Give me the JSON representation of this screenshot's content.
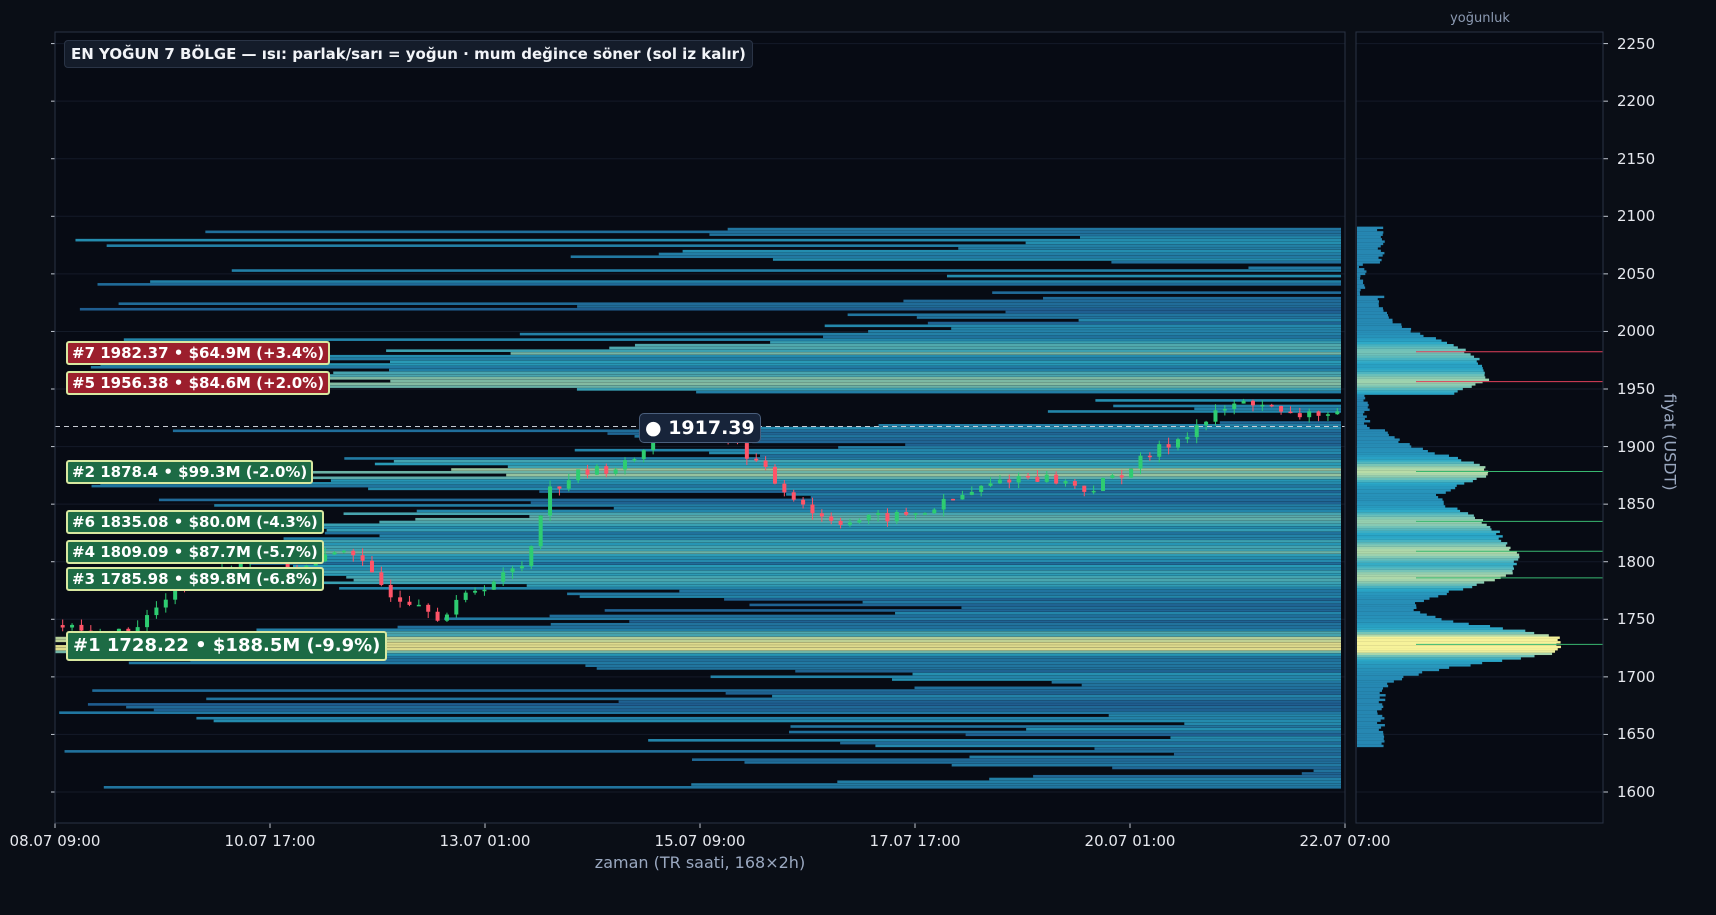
{
  "chart_data": {
    "type": "candlestick",
    "title": "EN YOĞUN 7 BÖLGE — ısı: parlak/sarı = yoğun · mum değince söner (sol iz kalır)",
    "xlabel": "zaman (TR saati, 168×2h)",
    "ylabel": "fiyat (USDT)",
    "profile_label": "yoğunluk",
    "ylim": [
      1575,
      2262
    ],
    "x_ticks": [
      "08.07 09:00",
      "10.07 17:00",
      "13.07 01:00",
      "15.07 09:00",
      "17.07 17:00",
      "20.07 01:00",
      "22.07 07:00"
    ],
    "y_ticks": [
      1600,
      1650,
      1700,
      1750,
      1800,
      1850,
      1900,
      1950,
      2000,
      2050,
      2100,
      2150,
      2200,
      2250
    ],
    "current_price": {
      "value": 1917.39,
      "label": "● 1917.39"
    },
    "zones": [
      {
        "rank": 7,
        "label": "#7  1982.37  •  $64.9M  (+3.4%)",
        "price": 1982.37,
        "volume_musd": 64.9,
        "change_pct": 3.4,
        "side": "above"
      },
      {
        "rank": 5,
        "label": "#5  1956.38  •  $84.6M  (+2.0%)",
        "price": 1956.38,
        "volume_musd": 84.6,
        "change_pct": 2.0,
        "side": "above"
      },
      {
        "rank": 2,
        "label": "#2  1878.4  •  $99.3M  (-2.0%)",
        "price": 1878.4,
        "volume_musd": 99.3,
        "change_pct": -2.0,
        "side": "below"
      },
      {
        "rank": 6,
        "label": "#6  1835.08  •  $80.0M  (-4.3%)",
        "price": 1835.08,
        "volume_musd": 80.0,
        "change_pct": -4.3,
        "side": "below"
      },
      {
        "rank": 4,
        "label": "#4  1809.09  •  $87.7M  (-5.7%)",
        "price": 1809.09,
        "volume_musd": 87.7,
        "change_pct": -5.7,
        "side": "below"
      },
      {
        "rank": 3,
        "label": "#3  1785.98  •  $89.8M  (-6.8%)",
        "price": 1785.98,
        "volume_musd": 89.8,
        "change_pct": -6.8,
        "side": "below"
      },
      {
        "rank": 1,
        "label": "#1  1728.22  •  $188.5M  (-9.9%)",
        "price": 1728.22,
        "volume_musd": 188.5,
        "change_pct": -9.9,
        "side": "below"
      }
    ],
    "price_path": [
      [
        0,
        1745
      ],
      [
        8,
        1735
      ],
      [
        16,
        1742
      ],
      [
        24,
        1770
      ],
      [
        30,
        1790
      ],
      [
        38,
        1800
      ],
      [
        46,
        1815
      ],
      [
        50,
        1790
      ],
      [
        56,
        1800
      ],
      [
        62,
        1815
      ],
      [
        66,
        1790
      ],
      [
        72,
        1770
      ],
      [
        78,
        1765
      ],
      [
        82,
        1750
      ],
      [
        88,
        1775
      ],
      [
        94,
        1785
      ],
      [
        100,
        1800
      ],
      [
        104,
        1860
      ],
      [
        110,
        1875
      ],
      [
        116,
        1880
      ],
      [
        122,
        1885
      ],
      [
        126,
        1905
      ],
      [
        132,
        1920
      ],
      [
        138,
        1918
      ],
      [
        142,
        1910
      ],
      [
        148,
        1890
      ],
      [
        154,
        1865
      ],
      [
        158,
        1855
      ],
      [
        162,
        1840
      ],
      [
        168,
        1835
      ],
      [
        176,
        1838
      ],
      [
        184,
        1842
      ],
      [
        190,
        1852
      ],
      [
        196,
        1862
      ],
      [
        202,
        1872
      ],
      [
        208,
        1875
      ],
      [
        214,
        1870
      ],
      [
        220,
        1862
      ],
      [
        226,
        1875
      ],
      [
        232,
        1890
      ],
      [
        238,
        1905
      ],
      [
        244,
        1920
      ],
      [
        250,
        1935
      ],
      [
        256,
        1940
      ],
      [
        262,
        1925
      ],
      [
        268,
        1930
      ],
      [
        274,
        1925
      ]
    ],
    "colors": {
      "up_candle": "#2ecc71",
      "down_candle": "#ff5468",
      "zone_up_bg": "#9c1f2d",
      "zone_down_bg": "#1d6b45",
      "heat_low": "#1e4a8a",
      "heat_mid": "#2aa8c8",
      "heat_high": "#f6f29a"
    }
  }
}
